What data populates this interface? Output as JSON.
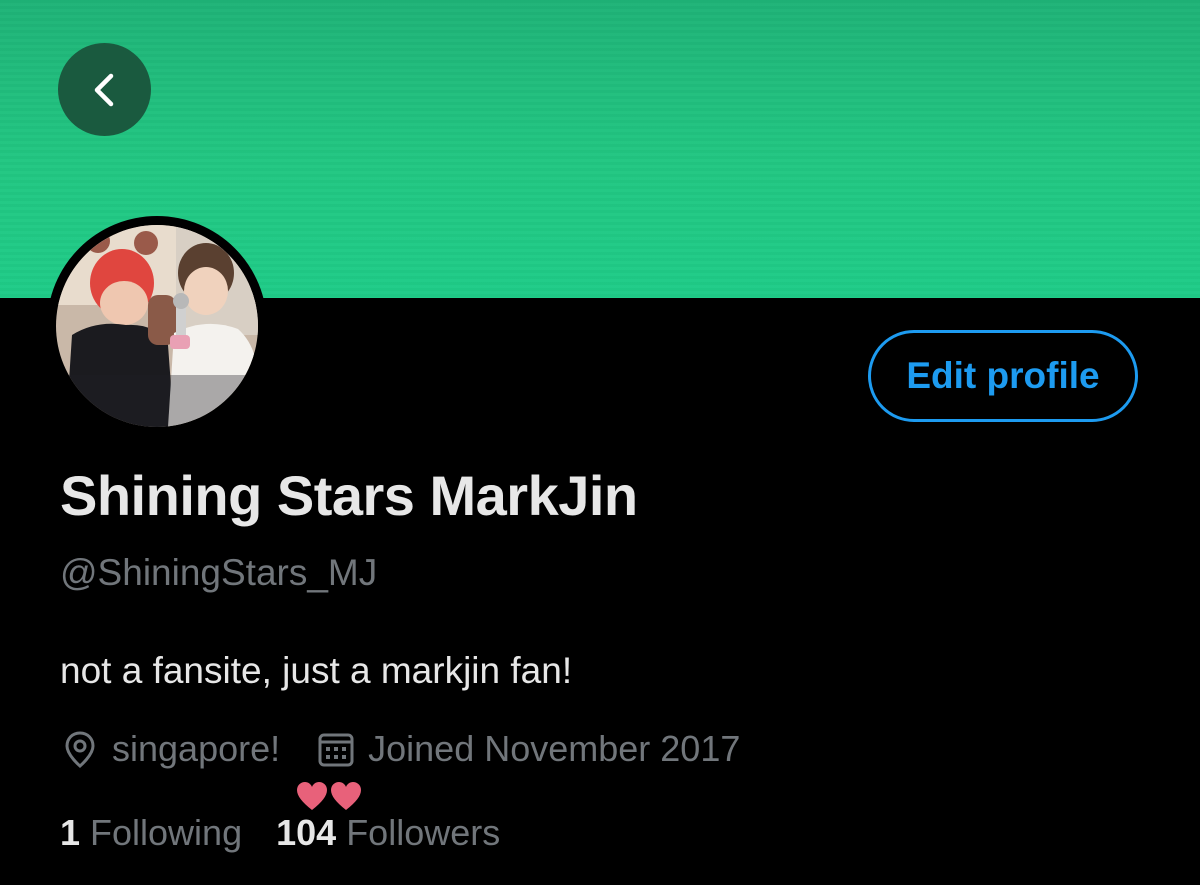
{
  "header": {
    "banner_color": "#21c07f",
    "back_button_icon": "chevron-left-icon"
  },
  "profile": {
    "display_name": "Shining Stars MarkJin",
    "handle": "@ShiningStars_MJ",
    "bio": "not a fansite, just a markjin fan!",
    "location_icon": "location-pin-icon",
    "location": "singapore!",
    "joined_icon": "calendar-icon",
    "joined": "Joined November 2017"
  },
  "actions": {
    "edit_profile_label": "Edit profile",
    "accent_color": "#1d9bf0"
  },
  "stats": {
    "following_count": "1",
    "following_label": "Following",
    "followers_count": "104",
    "followers_label": "Followers"
  },
  "decorations": {
    "sticker": "hearts-sticker",
    "sticker_color": "#e8617a"
  }
}
